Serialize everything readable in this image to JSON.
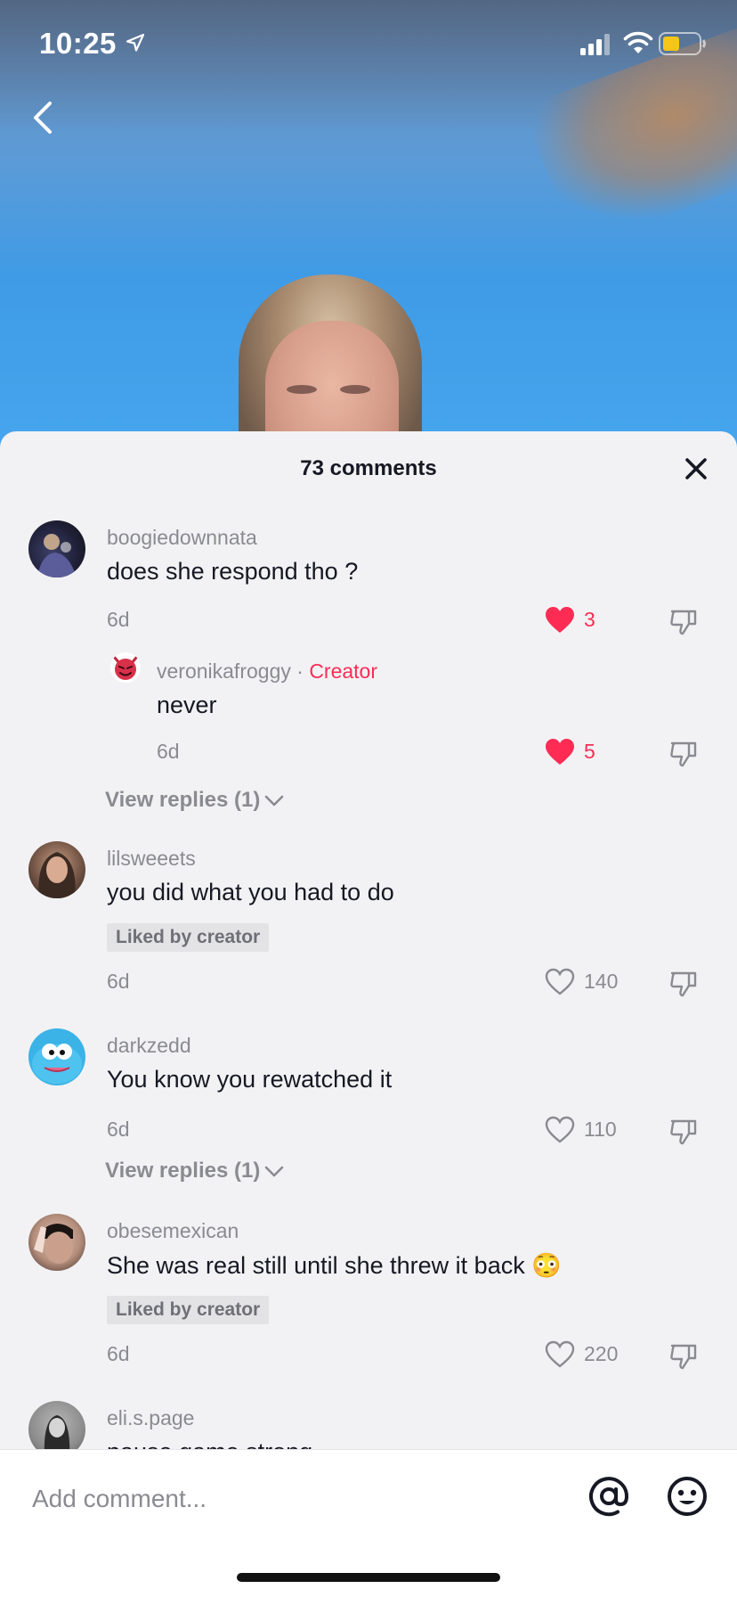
{
  "status_bar": {
    "time": "10:25",
    "icons": [
      "location-arrow-icon",
      "cellular-signal-icon",
      "wifi-icon",
      "battery-icon"
    ]
  },
  "navigation": {
    "back_icon": "chevron-left-icon"
  },
  "sheet": {
    "title": "73 comments",
    "close_icon": "close-icon"
  },
  "comments": [
    {
      "username": "boogiedownnata",
      "text": "does she respond tho ?",
      "time": "6d",
      "likes": "3",
      "liked": true,
      "reply": {
        "username": "veronikafroggy",
        "separator": " · ",
        "tag": "Creator",
        "text": "never",
        "time": "6d",
        "likes": "5",
        "liked": true
      },
      "view_replies": "View replies (1)"
    },
    {
      "username": "lilsweeets",
      "text": "you did what you had to do",
      "badge": "Liked by creator",
      "time": "6d",
      "likes": "140",
      "liked": false
    },
    {
      "username": "darkzedd",
      "text": "You know you rewatched it",
      "time": "6d",
      "likes": "110",
      "liked": false,
      "view_replies": "View replies (1)"
    },
    {
      "username": "obesemexican",
      "text": "She was real still until she threw it back 😳",
      "badge": "Liked by creator",
      "time": "6d",
      "likes": "220",
      "liked": false
    },
    {
      "username": "eli.s.page",
      "text": "pause game strong"
    }
  ],
  "input_bar": {
    "placeholder": "Add comment...",
    "mention_icon": "at-sign-icon",
    "emoji_icon": "smiley-face-icon"
  },
  "colors": {
    "accent_red": "#fe2c55",
    "muted_text": "#8a8b91",
    "primary_text": "#161823",
    "sheet_bg": "#f2f2f4",
    "battery_yellow": "#f5c518"
  }
}
